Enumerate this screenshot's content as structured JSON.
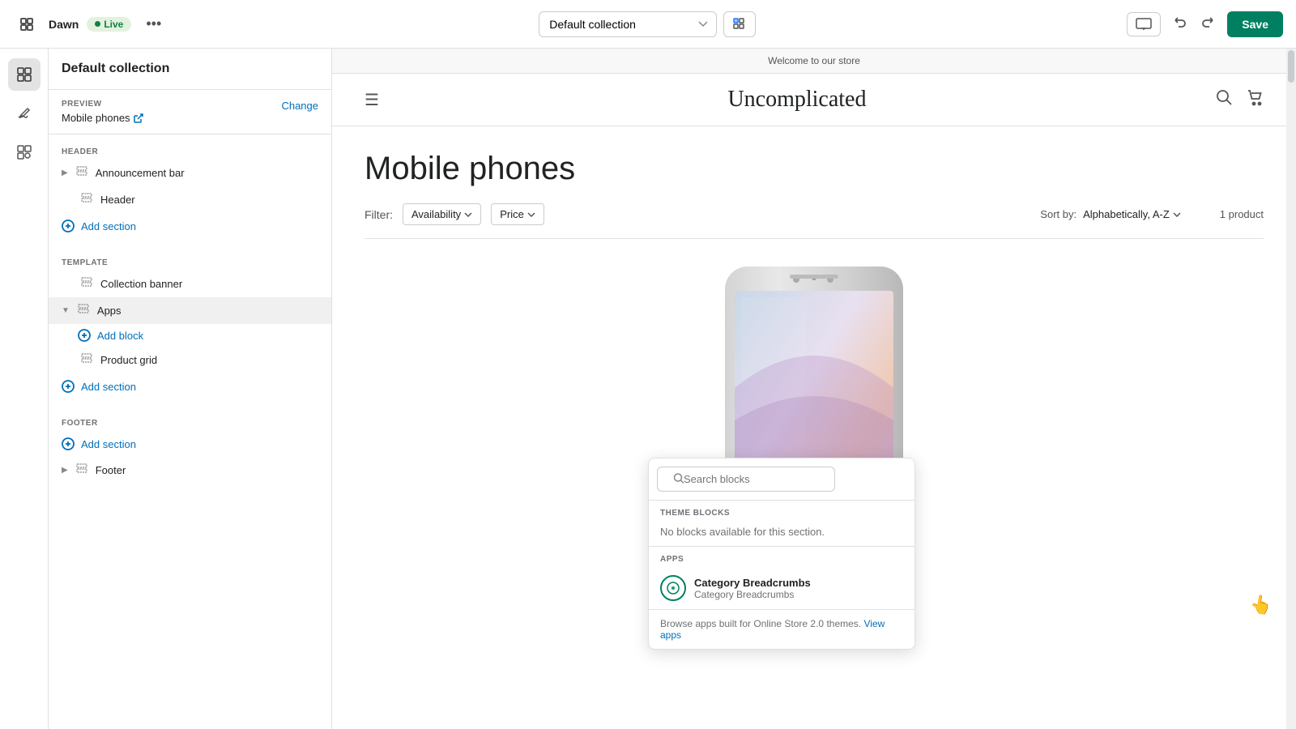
{
  "topbar": {
    "theme_name": "Dawn",
    "live_label": "Live",
    "more_icon": "•••",
    "dropdown_value": "Default collection",
    "save_label": "Save"
  },
  "sidebar": {
    "title": "Default collection",
    "preview_label": "PREVIEW",
    "preview_value": "Mobile phones",
    "change_label": "Change",
    "sections": {
      "header_label": "HEADER",
      "template_label": "TEMPLATE",
      "footer_label": "FOOTER"
    },
    "header_items": [
      {
        "label": "Announcement bar",
        "icon": "grid",
        "has_chevron": true
      },
      {
        "label": "Header",
        "icon": "grid",
        "has_chevron": false
      }
    ],
    "header_add": "Add section",
    "template_items": [
      {
        "label": "Collection banner",
        "icon": "grid",
        "has_chevron": false
      },
      {
        "label": "Apps",
        "icon": "grid",
        "has_chevron": true,
        "expanded": true
      }
    ],
    "add_block_label": "Add block",
    "template_items2": [
      {
        "label": "Product grid",
        "icon": "grid",
        "has_chevron": false
      }
    ],
    "template_add": "Add section",
    "footer_add": "Add section",
    "footer_items": [
      {
        "label": "Footer",
        "icon": "grid",
        "has_chevron": true
      }
    ]
  },
  "blocks_popup": {
    "search_placeholder": "Search blocks",
    "theme_blocks_label": "THEME BLOCKS",
    "no_blocks_text": "No blocks available for this section.",
    "apps_label": "APPS",
    "app_item": {
      "name": "Category Breadcrumbs",
      "sub": "Category Breadcrumbs"
    },
    "footer_text": "Browse apps built for Online Store 2.0 themes.",
    "footer_link_label": "View apps",
    "footer_link": "#"
  },
  "store": {
    "announcement": "Welcome to our store",
    "logo": "Uncomplicated",
    "page_title": "Mobile phones",
    "filter_label": "Filter:",
    "filter_availability": "Availability",
    "filter_price": "Price",
    "sort_label": "Sort by:",
    "sort_value": "Alphabetically, A-Z",
    "product_count": "1 product"
  }
}
